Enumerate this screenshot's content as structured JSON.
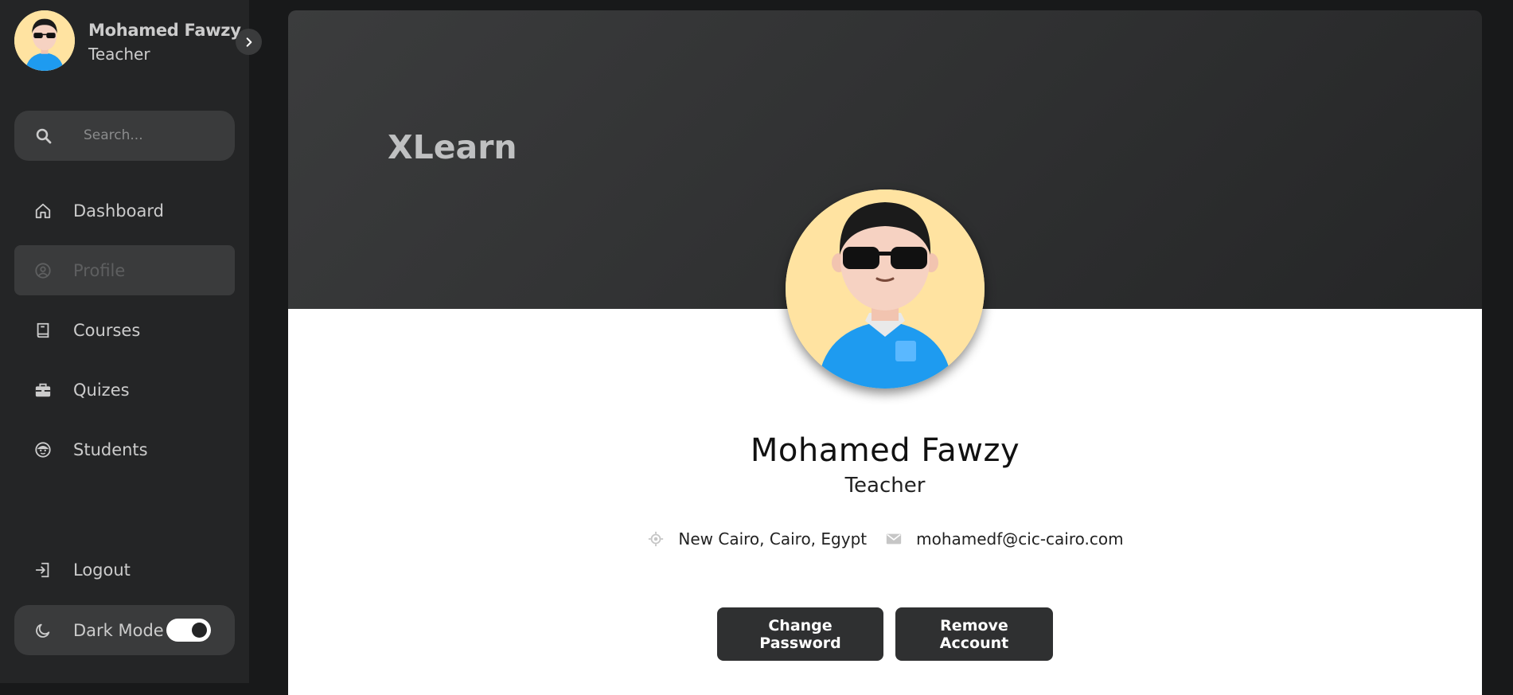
{
  "user": {
    "name": "Mohamed Fawzy",
    "role": "Teacher",
    "location": "New Cairo, Cairo, Egypt",
    "email": "mohamedf@cic-cairo.com"
  },
  "sidebar": {
    "search_placeholder": "Search...",
    "items": [
      {
        "label": "Dashboard",
        "icon": "home-icon"
      },
      {
        "label": "Profile",
        "icon": "user-circle-icon"
      },
      {
        "label": "Courses",
        "icon": "book-icon"
      },
      {
        "label": "Quizes",
        "icon": "briefcase-icon"
      },
      {
        "label": "Students",
        "icon": "student-face-icon"
      }
    ],
    "logout_label": "Logout",
    "dark_mode_label": "Dark Mode",
    "dark_mode_on": true
  },
  "main": {
    "brand": "XLearn",
    "change_password_label": "Change Password",
    "remove_account_label": "Remove Account"
  },
  "colors": {
    "sidebar_bg": "#242526",
    "page_bg": "#18191a",
    "button_bg": "#2f3031",
    "avatar_bg": "#ffe3a1"
  }
}
